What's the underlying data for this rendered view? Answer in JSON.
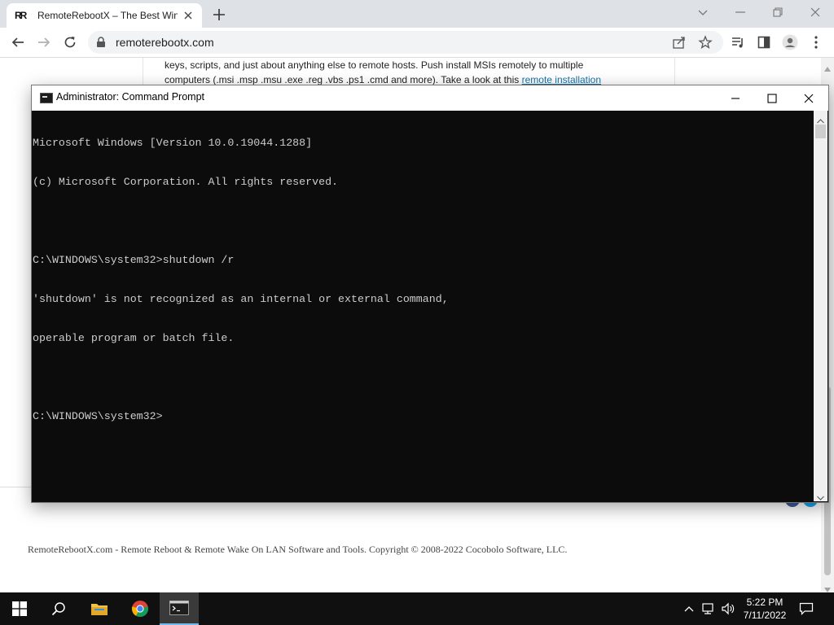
{
  "browser": {
    "tab": {
      "title": "RemoteRebootX – The Best Wind",
      "favicon_text": "RR"
    },
    "url": "remoterebootx.com"
  },
  "page": {
    "line1": "keys, scripts, and just about anything else to remote hosts. Push install MSIs remotely to multiple",
    "line2": "computers (.msi .msp .msu .exe .reg .vbs .ps1 .cmd and more). Take a look at this",
    "link_text": "remote installation",
    "footer": "RemoteRebootX.com - Remote Reboot & Remote Wake On LAN Software and Tools. Copyright © 2008-2022 Cocobolo Software, LLC."
  },
  "cmd": {
    "title": "Administrator: Command Prompt",
    "lines": [
      "Microsoft Windows [Version 10.0.19044.1288]",
      "(c) Microsoft Corporation. All rights reserved.",
      "",
      "C:\\WINDOWS\\system32>shutdown /r",
      "'shutdown' is not recognized as an internal or external command,",
      "operable program or batch file.",
      "",
      "C:\\WINDOWS\\system32>"
    ]
  },
  "taskbar": {
    "time": "5:22 PM",
    "date": "7/11/2022",
    "pinned": [
      "windows-start",
      "search",
      "file-explorer",
      "chrome",
      "command-prompt"
    ]
  },
  "colors": {
    "cmd_background": "#0c0c0c",
    "cmd_text": "#cccccc",
    "taskbar": "#101010",
    "tabstrip": "#dee1e6",
    "link": "#1a73a8"
  }
}
